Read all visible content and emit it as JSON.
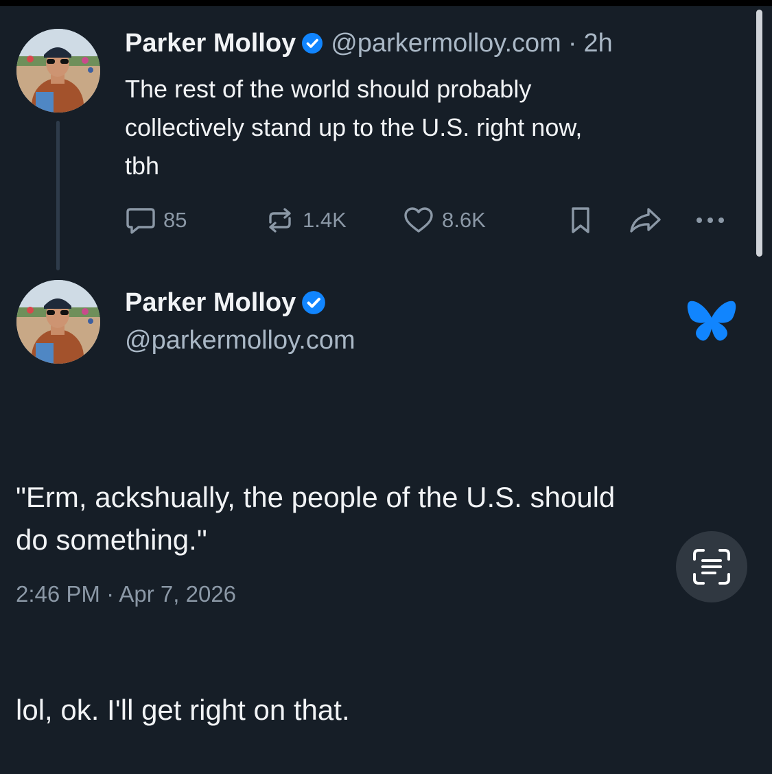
{
  "colors": {
    "background": "#161e27",
    "accent_blue": "#1185fe",
    "muted_text": "#8b98a6",
    "handle_text": "#aab8c6"
  },
  "parent_post": {
    "author": {
      "display_name": "Parker Molloy",
      "verified_icon": "verified-check-icon",
      "handle": "@parkermolloy.com",
      "separator": "·",
      "time_ago": "2h"
    },
    "text": "The rest of the world should probably\ncollectively stand up to the U.S. right now,\ntbh",
    "actions": {
      "reply": {
        "icon": "reply-icon",
        "count": "85"
      },
      "repost": {
        "icon": "repost-icon",
        "count": "1.4K"
      },
      "like": {
        "icon": "heart-icon",
        "count": "8.6K"
      },
      "bookmark": {
        "icon": "bookmark-icon"
      },
      "share": {
        "icon": "share-icon"
      },
      "more": {
        "icon": "more-icon"
      }
    }
  },
  "main_post": {
    "author": {
      "display_name": "Parker Molloy",
      "verified_icon": "verified-check-icon",
      "handle": "@parkermolloy.com"
    },
    "platform_icon": "bluesky-butterfly-icon",
    "text_paragraph_1": "\"Erm, ackshually, the people of the U.S. should\ndo something.\"",
    "text_paragraph_2": "lol, ok. I'll get right on that.",
    "timestamp": "2:46 PM · Apr 7, 2026"
  },
  "overlay": {
    "scan_text_icon": "live-text-scan-icon"
  }
}
